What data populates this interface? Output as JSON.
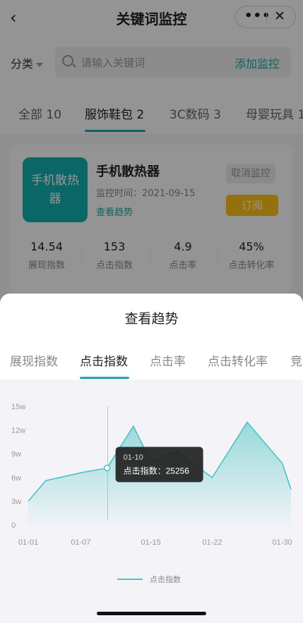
{
  "nav": {
    "back_icon": "chevron-left-icon",
    "title": "关键词监控",
    "more_icon": "more-dots-icon",
    "close_icon": "close-icon"
  },
  "filter": {
    "category_label": "分类",
    "search_placeholder": "请输入关键词",
    "add_label": "添加监控"
  },
  "tabs": [
    {
      "label": "全部 10"
    },
    {
      "label": "服饰鞋包 2",
      "active": true
    },
    {
      "label": "3C数码 3"
    },
    {
      "label": "母婴玩具 1"
    }
  ],
  "card": {
    "thumb_text": "手机散热器",
    "keyword": "手机散热器",
    "monitor_time": "监控时间：2021-09-15",
    "trend_link": "查看趋势",
    "cancel_label": "取消监控",
    "subscribe_label": "订阅",
    "stats": [
      {
        "value": "14.54",
        "label": "展现指数"
      },
      {
        "value": "153",
        "label": "点击指数"
      },
      {
        "value": "4.9",
        "label": "点击率"
      },
      {
        "value": "45%",
        "label": "点击转化率"
      }
    ]
  },
  "sheet": {
    "title": "查看趋势",
    "tabs": [
      {
        "label": "展现指数"
      },
      {
        "label": "点击指数",
        "active": true
      },
      {
        "label": "点击率"
      },
      {
        "label": "点击转化率"
      },
      {
        "label": "竞"
      }
    ]
  },
  "chart_data": {
    "type": "area",
    "x": [
      "01-01",
      "01-03",
      "01-07",
      "01-10",
      "01-13",
      "01-15",
      "01-18",
      "01-22",
      "01-26",
      "01-30",
      "01-31"
    ],
    "series": [
      {
        "name": "点击指数",
        "values": [
          30000,
          56000,
          66000,
          72000,
          125000,
          80000,
          93000,
          60000,
          130000,
          78000,
          45000
        ]
      }
    ],
    "x_tick_labels": [
      "01-01",
      "01-07",
      "01-15",
      "01-22",
      "01-30"
    ],
    "y_tick_labels": [
      "0",
      "3w",
      "6w",
      "9w",
      "12w",
      "15w"
    ],
    "ylim": [
      0,
      150000
    ],
    "legend": "bottom",
    "color": "#4cc3c3",
    "tooltip": {
      "date": "01-10",
      "text": "点击指数：25256",
      "index": 3
    }
  }
}
